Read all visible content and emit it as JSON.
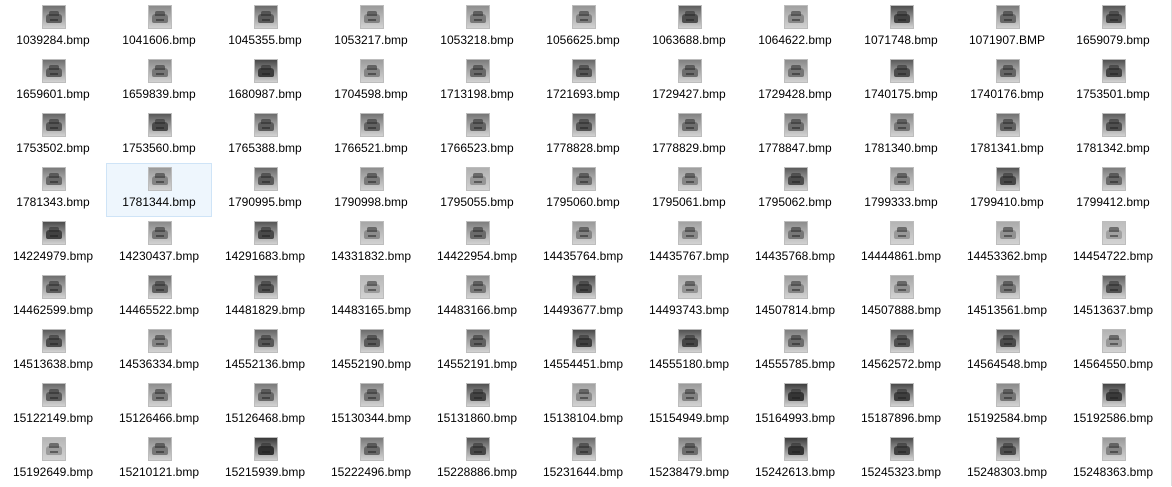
{
  "window": {
    "view": "Large icons"
  },
  "colors": {
    "selection_fill": "#eef6fd",
    "selection_border": "#cfe4f7",
    "label": "#000000"
  },
  "files": [
    {
      "name": "1039284.bmp",
      "shade": "#707070",
      "icon": "grayscale-car-image-icon"
    },
    {
      "name": "1041606.bmp",
      "shade": "#8a8a8a",
      "icon": "grayscale-car-image-icon"
    },
    {
      "name": "1045355.bmp",
      "shade": "#6a6a6a",
      "icon": "grayscale-car-image-icon"
    },
    {
      "name": "1053217.bmp",
      "shade": "#9a9a9a",
      "icon": "grayscale-car-image-icon"
    },
    {
      "name": "1053218.bmp",
      "shade": "#8e8e8e",
      "icon": "grayscale-car-image-icon"
    },
    {
      "name": "1056625.bmp",
      "shade": "#949494",
      "icon": "grayscale-car-image-icon"
    },
    {
      "name": "1063688.bmp",
      "shade": "#5c5c5c",
      "icon": "grayscale-car-image-icon"
    },
    {
      "name": "1064622.bmp",
      "shade": "#a0a0a0",
      "icon": "grayscale-car-image-icon"
    },
    {
      "name": "1071748.bmp",
      "shade": "#4e4e4e",
      "icon": "grayscale-car-image-icon"
    },
    {
      "name": "1071907.BMP",
      "shade": "#7a7a7a",
      "icon": "grayscale-car-image-icon"
    },
    {
      "name": "1659079.bmp",
      "shade": "#555555",
      "icon": "grayscale-car-image-icon"
    },
    {
      "name": "1659601.bmp",
      "shade": "#6e6e6e",
      "icon": "grayscale-car-image-icon"
    },
    {
      "name": "1659839.bmp",
      "shade": "#8c8c8c",
      "icon": "grayscale-car-image-icon"
    },
    {
      "name": "1680987.bmp",
      "shade": "#484848",
      "icon": "grayscale-car-image-icon"
    },
    {
      "name": "1704598.bmp",
      "shade": "#9c9c9c",
      "icon": "grayscale-car-image-icon"
    },
    {
      "name": "1713198.bmp",
      "shade": "#7c7c7c",
      "icon": "grayscale-car-image-icon"
    },
    {
      "name": "1721693.bmp",
      "shade": "#686868",
      "icon": "grayscale-car-image-icon"
    },
    {
      "name": "1729427.bmp",
      "shade": "#808080",
      "icon": "grayscale-car-image-icon"
    },
    {
      "name": "1729428.bmp",
      "shade": "#8a8a8a",
      "icon": "grayscale-car-image-icon"
    },
    {
      "name": "1740175.bmp",
      "shade": "#5a5a5a",
      "icon": "grayscale-car-image-icon"
    },
    {
      "name": "1740176.bmp",
      "shade": "#787878",
      "icon": "grayscale-car-image-icon"
    },
    {
      "name": "1753501.bmp",
      "shade": "#505050",
      "icon": "grayscale-car-image-icon"
    },
    {
      "name": "1753502.bmp",
      "shade": "#666666",
      "icon": "grayscale-car-image-icon"
    },
    {
      "name": "1753560.bmp",
      "shade": "#585858",
      "icon": "grayscale-car-image-icon"
    },
    {
      "name": "1765388.bmp",
      "shade": "#6c6c6c",
      "icon": "grayscale-car-image-icon"
    },
    {
      "name": "1766521.bmp",
      "shade": "#747474",
      "icon": "grayscale-car-image-icon"
    },
    {
      "name": "1766523.bmp",
      "shade": "#767676",
      "icon": "grayscale-car-image-icon"
    },
    {
      "name": "1778828.bmp",
      "shade": "#626262",
      "icon": "grayscale-car-image-icon"
    },
    {
      "name": "1778829.bmp",
      "shade": "#828282",
      "icon": "grayscale-car-image-icon"
    },
    {
      "name": "1778847.bmp",
      "shade": "#7e7e7e",
      "icon": "grayscale-car-image-icon"
    },
    {
      "name": "1781340.bmp",
      "shade": "#8a8a8a",
      "icon": "grayscale-car-image-icon"
    },
    {
      "name": "1781341.bmp",
      "shade": "#727272",
      "icon": "grayscale-car-image-icon"
    },
    {
      "name": "1781342.bmp",
      "shade": "#5e5e5e",
      "icon": "grayscale-car-image-icon"
    },
    {
      "name": "1781343.bmp",
      "shade": "#7a7a7a",
      "icon": "grayscale-car-image-icon"
    },
    {
      "name": "1781344.bmp",
      "shade": "#9a9a9a",
      "icon": "grayscale-car-image-icon",
      "selected": true
    },
    {
      "name": "1790995.bmp",
      "shade": "#6a6a6a",
      "icon": "grayscale-car-image-icon"
    },
    {
      "name": "1790998.bmp",
      "shade": "#8e8e8e",
      "icon": "grayscale-car-image-icon"
    },
    {
      "name": "1795055.bmp",
      "shade": "#b0b0b0",
      "icon": "grayscale-car-image-icon"
    },
    {
      "name": "1795060.bmp",
      "shade": "#848484",
      "icon": "grayscale-car-image-icon"
    },
    {
      "name": "1795061.bmp",
      "shade": "#9e9e9e",
      "icon": "grayscale-car-image-icon"
    },
    {
      "name": "1795062.bmp",
      "shade": "#5a5a5a",
      "icon": "grayscale-car-image-icon"
    },
    {
      "name": "1799333.bmp",
      "shade": "#969696",
      "icon": "grayscale-car-image-icon"
    },
    {
      "name": "1799410.bmp",
      "shade": "#545454",
      "icon": "grayscale-car-image-icon"
    },
    {
      "name": "1799412.bmp",
      "shade": "#7c7c7c",
      "icon": "grayscale-car-image-icon"
    },
    {
      "name": "14224979.bmp",
      "shade": "#4c4c4c",
      "icon": "grayscale-car-image-icon"
    },
    {
      "name": "14230437.bmp",
      "shade": "#8a8a8a",
      "icon": "grayscale-car-image-icon"
    },
    {
      "name": "14291683.bmp",
      "shade": "#565656",
      "icon": "grayscale-car-image-icon"
    },
    {
      "name": "14331832.bmp",
      "shade": "#a6a6a6",
      "icon": "grayscale-car-image-icon"
    },
    {
      "name": "14422954.bmp",
      "shade": "#7e7e7e",
      "icon": "grayscale-car-image-icon"
    },
    {
      "name": "14435764.bmp",
      "shade": "#9a9a9a",
      "icon": "grayscale-car-image-icon"
    },
    {
      "name": "14435767.bmp",
      "shade": "#a2a2a2",
      "icon": "grayscale-car-image-icon"
    },
    {
      "name": "14435768.bmp",
      "shade": "#8c8c8c",
      "icon": "grayscale-car-image-icon"
    },
    {
      "name": "14444861.bmp",
      "shade": "#b4b4b4",
      "icon": "grayscale-car-image-icon"
    },
    {
      "name": "14453362.bmp",
      "shade": "#aaaaaa",
      "icon": "grayscale-car-image-icon"
    },
    {
      "name": "14454722.bmp",
      "shade": "#bdbdbd",
      "icon": "grayscale-car-image-icon"
    },
    {
      "name": "14462599.bmp",
      "shade": "#6e6e6e",
      "icon": "grayscale-car-image-icon"
    },
    {
      "name": "14465522.bmp",
      "shade": "#707070",
      "icon": "grayscale-car-image-icon"
    },
    {
      "name": "14481829.bmp",
      "shade": "#5c5c5c",
      "icon": "grayscale-car-image-icon"
    },
    {
      "name": "14483165.bmp",
      "shade": "#b8b8b8",
      "icon": "grayscale-car-image-icon"
    },
    {
      "name": "14483166.bmp",
      "shade": "#8e8e8e",
      "icon": "grayscale-car-image-icon"
    },
    {
      "name": "14493677.bmp",
      "shade": "#505050",
      "icon": "grayscale-car-image-icon"
    },
    {
      "name": "14493743.bmp",
      "shade": "#aeaeae",
      "icon": "grayscale-car-image-icon"
    },
    {
      "name": "14507814.bmp",
      "shade": "#9c9c9c",
      "icon": "grayscale-car-image-icon"
    },
    {
      "name": "14507888.bmp",
      "shade": "#a8a8a8",
      "icon": "grayscale-car-image-icon"
    },
    {
      "name": "14513561.bmp",
      "shade": "#8a8a8a",
      "icon": "grayscale-car-image-icon"
    },
    {
      "name": "14513637.bmp",
      "shade": "#626262",
      "icon": "grayscale-car-image-icon"
    },
    {
      "name": "14513638.bmp",
      "shade": "#5a5a5a",
      "icon": "grayscale-car-image-icon"
    },
    {
      "name": "14536334.bmp",
      "shade": "#9a9a9a",
      "icon": "grayscale-car-image-icon"
    },
    {
      "name": "14552136.bmp",
      "shade": "#666666",
      "icon": "grayscale-car-image-icon"
    },
    {
      "name": "14552190.bmp",
      "shade": "#6c6c6c",
      "icon": "grayscale-car-image-icon"
    },
    {
      "name": "14552191.bmp",
      "shade": "#727272",
      "icon": "grayscale-car-image-icon"
    },
    {
      "name": "14554451.bmp",
      "shade": "#4a4a4a",
      "icon": "grayscale-car-image-icon"
    },
    {
      "name": "14555180.bmp",
      "shade": "#525252",
      "icon": "grayscale-car-image-icon"
    },
    {
      "name": "14555785.bmp",
      "shade": "#7e7e7e",
      "icon": "grayscale-car-image-icon"
    },
    {
      "name": "14562572.bmp",
      "shade": "#5e5e5e",
      "icon": "grayscale-car-image-icon"
    },
    {
      "name": "14564548.bmp",
      "shade": "#585858",
      "icon": "grayscale-car-image-icon"
    },
    {
      "name": "14564550.bmp",
      "shade": "#b2b2b2",
      "icon": "grayscale-car-image-icon"
    },
    {
      "name": "15122149.bmp",
      "shade": "#6a6a6a",
      "icon": "grayscale-car-image-icon"
    },
    {
      "name": "15126466.bmp",
      "shade": "#8e8e8e",
      "icon": "grayscale-car-image-icon"
    },
    {
      "name": "15126468.bmp",
      "shade": "#7a7a7a",
      "icon": "grayscale-car-image-icon"
    },
    {
      "name": "15130344.bmp",
      "shade": "#868686",
      "icon": "grayscale-car-image-icon"
    },
    {
      "name": "15131860.bmp",
      "shade": "#505050",
      "icon": "grayscale-car-image-icon"
    },
    {
      "name": "15138104.bmp",
      "shade": "#a2a2a2",
      "icon": "grayscale-car-image-icon"
    },
    {
      "name": "15154949.bmp",
      "shade": "#9a9a9a",
      "icon": "grayscale-car-image-icon"
    },
    {
      "name": "15164993.bmp",
      "shade": "#3e3e3e",
      "icon": "grayscale-car-image-icon"
    },
    {
      "name": "15187896.bmp",
      "shade": "#4a4a4a",
      "icon": "grayscale-car-image-icon"
    },
    {
      "name": "15192584.bmp",
      "shade": "#8a8a8a",
      "icon": "grayscale-car-image-icon"
    },
    {
      "name": "15192586.bmp",
      "shade": "#444444",
      "icon": "grayscale-car-image-icon"
    },
    {
      "name": "15192649.bmp",
      "shade": "#b6b6b6",
      "icon": "grayscale-car-image-icon"
    },
    {
      "name": "15210121.bmp",
      "shade": "#8c8c8c",
      "icon": "grayscale-car-image-icon"
    },
    {
      "name": "15215939.bmp",
      "shade": "#383838",
      "icon": "grayscale-car-image-icon"
    },
    {
      "name": "15222496.bmp",
      "shade": "#7a7a7a",
      "icon": "grayscale-car-image-icon"
    },
    {
      "name": "15228886.bmp",
      "shade": "#545454",
      "icon": "grayscale-car-image-icon"
    },
    {
      "name": "15231644.bmp",
      "shade": "#6a6a6a",
      "icon": "grayscale-car-image-icon"
    },
    {
      "name": "15238479.bmp",
      "shade": "#808080",
      "icon": "grayscale-car-image-icon"
    },
    {
      "name": "15242613.bmp",
      "shade": "#3c3c3c",
      "icon": "grayscale-car-image-icon"
    },
    {
      "name": "15245323.bmp",
      "shade": "#4c4c4c",
      "icon": "grayscale-car-image-icon"
    },
    {
      "name": "15248303.bmp",
      "shade": "#5c5c5c",
      "icon": "grayscale-car-image-icon"
    },
    {
      "name": "15248363.bmp",
      "shade": "#9a9a9a",
      "icon": "grayscale-car-image-icon"
    }
  ]
}
